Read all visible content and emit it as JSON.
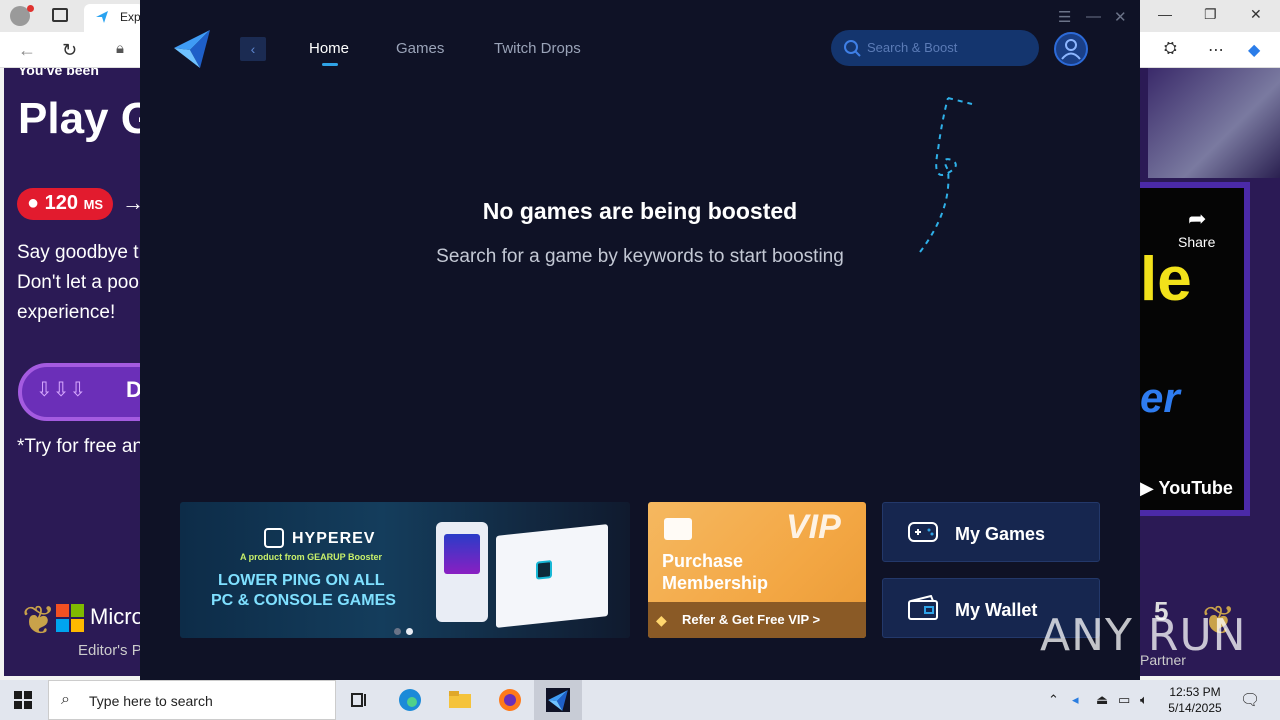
{
  "browser": {
    "tab_label": "Exp",
    "window_controls": [
      "—",
      "❐",
      "✕"
    ]
  },
  "background_page_left": {
    "top_text": "You've been",
    "title": "Play G",
    "ping_value": "120",
    "ping_unit": "MS",
    "body_lines": [
      "Say goodbye t",
      "Don't let a poo",
      "experience!"
    ],
    "download_label": "D",
    "try_text": "*Try for free an",
    "ms_text": "Micro",
    "editor_text": "Editor's P"
  },
  "background_page_right": {
    "share_label": "Share",
    "video_text_1": "le",
    "video_text_2": "er",
    "youtube_label": "YouTube",
    "badge_num": "5",
    "partner_label": "Partner"
  },
  "watermark": "ANY RUN",
  "app": {
    "nav": [
      {
        "label": "Home",
        "active": true
      },
      {
        "label": "Games",
        "active": false
      },
      {
        "label": "Twitch Drops",
        "active": false
      }
    ],
    "search_placeholder": "Search & Boost",
    "empty_title": "No games are being boosted",
    "empty_subtitle": "Search for a game by keywords to start boosting",
    "banner": {
      "brand": "HYPEREV",
      "product_line": "A product from GEARUP Booster",
      "line1": "LOWER PING ON ALL",
      "line2": "PC & CONSOLE GAMES"
    },
    "vip": {
      "badge": "VIP",
      "title_line1": "Purchase",
      "title_line2": "Membership",
      "refer_label": "Refer & Get Free VIP >"
    },
    "side_buttons": [
      {
        "label": "My Games"
      },
      {
        "label": "My Wallet"
      }
    ],
    "accent_color": "#2fa3e6"
  },
  "taskbar": {
    "search_placeholder": "Type here to search",
    "time": "12:53 PM",
    "date": "5/14/2025"
  }
}
